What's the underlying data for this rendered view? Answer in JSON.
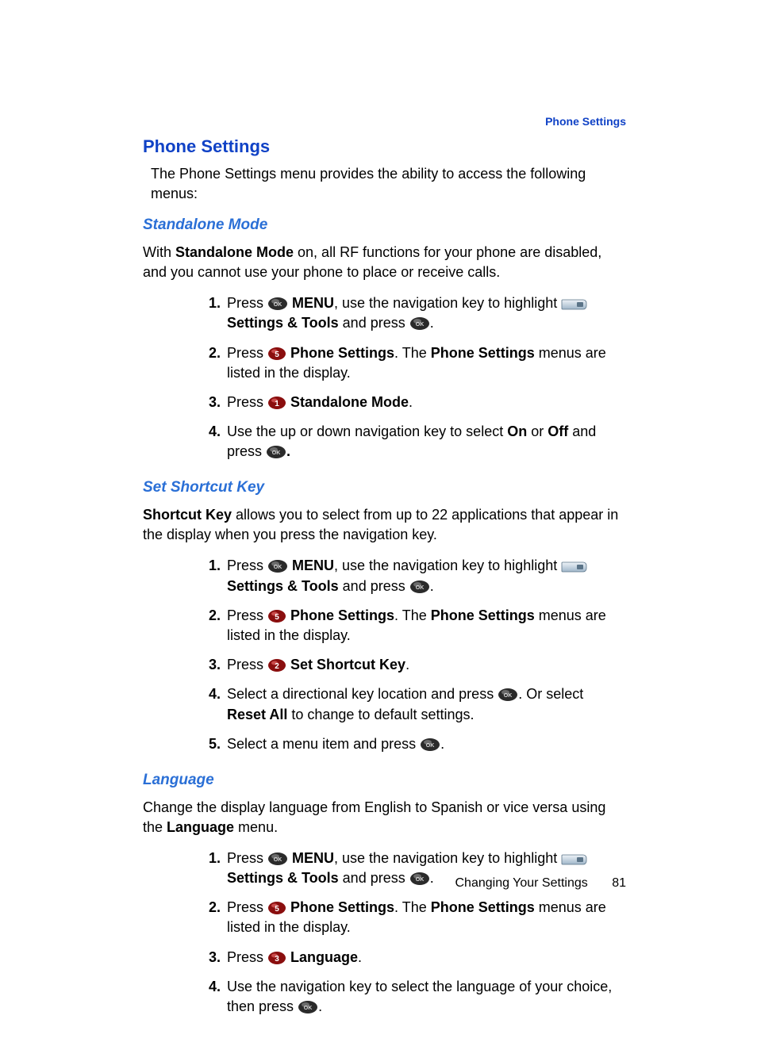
{
  "header": {
    "tag": "Phone Settings"
  },
  "section": {
    "title": "Phone Settings",
    "intro": "The Phone Settings menu provides the ability to access the following menus:"
  },
  "standalone": {
    "title": "Standalone Mode",
    "p_a": "With ",
    "p_b": "Standalone Mode",
    "p_c": " on, all RF functions for your phone are disabled, and you cannot use your phone to place or receive calls.",
    "steps": {
      "s1": {
        "n": "1.",
        "a": "Press ",
        "b": "MENU",
        "c": ", use the navigation key to highlight ",
        "d": "Settings & Tools",
        "e": " and press ",
        "f": "."
      },
      "s2": {
        "n": "2.",
        "a": "Press ",
        "b": "Phone Settings",
        "c": ". The ",
        "d": "Phone Settings",
        "e": " menus are listed in the display."
      },
      "s3": {
        "n": "3.",
        "a": "Press ",
        "b": "Standalone Mode",
        "c": "."
      },
      "s4": {
        "n": "4.",
        "a": "Use the up or down navigation key to select ",
        "b": "On",
        "c": " or ",
        "d": "Off",
        "e": " and press ",
        "f": "."
      }
    }
  },
  "shortcut": {
    "title": "Set Shortcut Key",
    "p_a": "Shortcut Key",
    "p_b": " allows you to select from up to 22 applications that appear in the display when you press the navigation key.",
    "steps": {
      "s1": {
        "n": "1.",
        "a": "Press ",
        "b": "MENU",
        "c": ", use the navigation key to highlight ",
        "d": "Settings & Tools",
        "e": " and press ",
        "f": "."
      },
      "s2": {
        "n": "2.",
        "a": "Press ",
        "b": "Phone Settings",
        "c": ". The ",
        "d": "Phone Settings",
        "e": " menus are listed in the display."
      },
      "s3": {
        "n": "3.",
        "a": "Press ",
        "b": "Set Shortcut Key",
        "c": "."
      },
      "s4": {
        "n": "4.",
        "a": "Select a directional key location and press ",
        "b": ". Or select ",
        "c": "Reset All",
        "d": " to change to default settings."
      },
      "s5": {
        "n": "5.",
        "a": "Select a menu item and press ",
        "b": "."
      }
    }
  },
  "language": {
    "title": "Language",
    "p_a": "Change the display language from English to Spanish or vice versa using the ",
    "p_b": "Language",
    "p_c": " menu.",
    "steps": {
      "s1": {
        "n": "1.",
        "a": "Press ",
        "b": "MENU",
        "c": ", use the navigation key to highlight ",
        "d": "Settings & Tools",
        "e": " and press ",
        "f": "."
      },
      "s2": {
        "n": "2.",
        "a": "Press ",
        "b": "Phone Settings",
        "c": ". The ",
        "d": "Phone Settings",
        "e": " menus are listed in the display."
      },
      "s3": {
        "n": "3.",
        "a": "Press ",
        "b": "Language",
        "c": "."
      },
      "s4": {
        "n": "4.",
        "a": "Use the navigation key to select the language of your choice, then press ",
        "b": "."
      }
    }
  },
  "footer": {
    "chapter": "Changing Your Settings",
    "page": "81"
  },
  "key_labels": {
    "k1": "1",
    "k2": "2",
    "k3": "3",
    "k5": "5"
  }
}
